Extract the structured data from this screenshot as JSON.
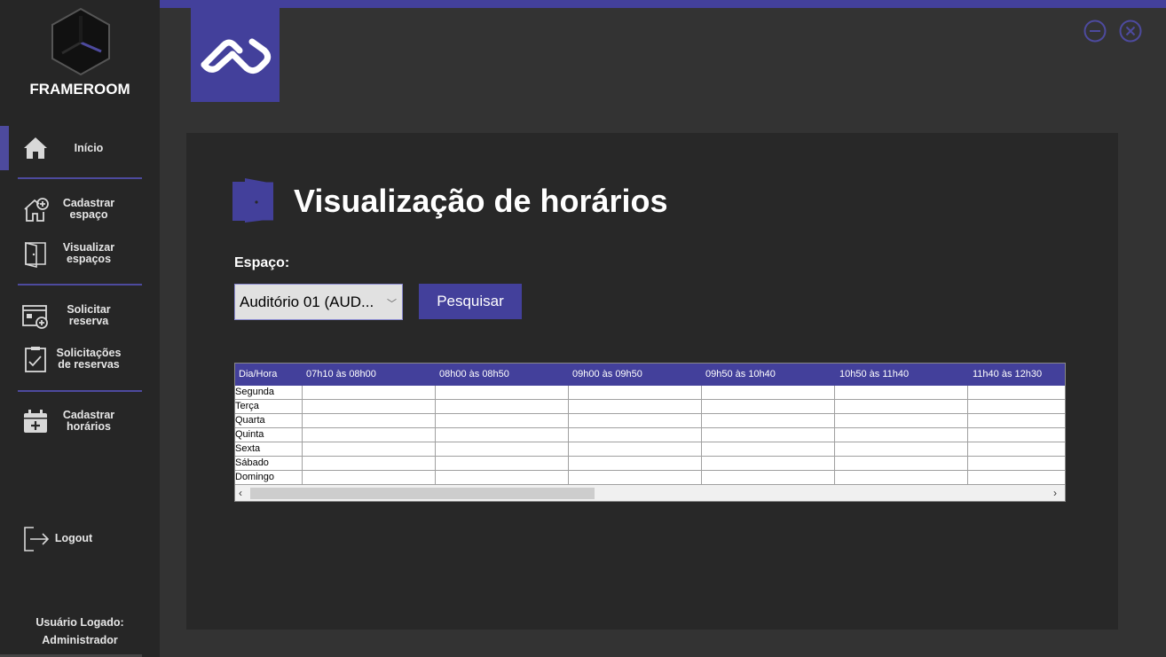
{
  "app": {
    "brand": "FRAMEROOM"
  },
  "sidebar": {
    "items": [
      {
        "label": "Início",
        "icon": "home-icon"
      },
      {
        "label": "Cadastrar espaço",
        "icon": "house-plus-icon"
      },
      {
        "label": "Visualizar espaços",
        "icon": "door-icon"
      },
      {
        "label": "Solicitar reserva",
        "icon": "calendar-add-icon"
      },
      {
        "label": "Solicitações de reservas",
        "icon": "clipboard-check-icon"
      },
      {
        "label": "Cadastrar horários",
        "icon": "calendar-plus-icon"
      },
      {
        "label": "Logout",
        "icon": "logout-icon"
      }
    ],
    "user_label": "Usuário Logado:",
    "user_name": "Administrador"
  },
  "main": {
    "title": "Visualização de horários",
    "field_label": "Espaço:",
    "select_value": "Auditório 01 (AUD...",
    "search_label": "Pesquisar",
    "grid": {
      "columns": [
        "Dia/Hora",
        "07h10 às 08h00",
        "08h00 às 08h50",
        "09h00 às 09h50",
        "09h50 às 10h40",
        "10h50 às 11h40",
        "11h40 às 12h30"
      ],
      "rows": [
        "Segunda",
        "Terça",
        "Quarta",
        "Quinta",
        "Sexta",
        "Sábado",
        "Domingo"
      ]
    }
  },
  "colors": {
    "accent": "#43409b",
    "sidebar_bg": "#262626",
    "panel_bg": "#282828",
    "page_bg": "#333333"
  }
}
